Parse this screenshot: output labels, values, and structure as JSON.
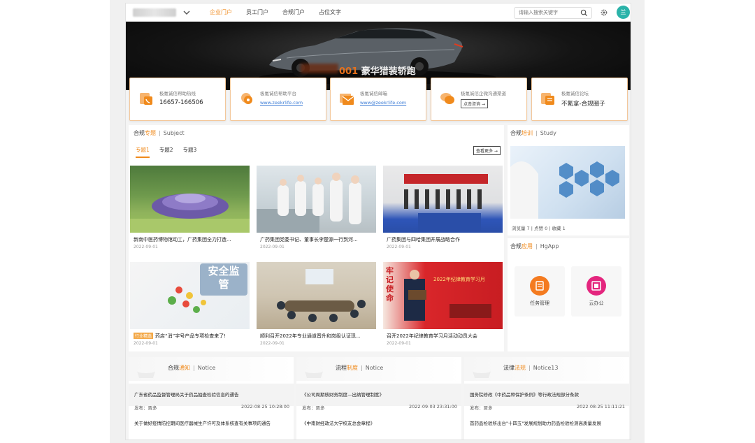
{
  "nav": {
    "tabs": [
      {
        "label": "企业门户"
      },
      {
        "label": "员工门户"
      },
      {
        "label": "合规门户"
      },
      {
        "label": "占位文字"
      }
    ],
    "search_placeholder": "请输入搜索关键字",
    "avatar_text": "兰"
  },
  "banner": {
    "number": "001",
    "title": "豪华猎装轿跑"
  },
  "cards": [
    {
      "label": "极氪诚信帮助热线",
      "value": "16657-166506"
    },
    {
      "label": "极氪诚信帮助平台",
      "link": "www.zeekrlife.com"
    },
    {
      "label": "极氪诚信邮箱",
      "link": "www@zeekrlife.com"
    },
    {
      "label": "极氪诚信企微沟通渠道",
      "button": "点击咨询 →"
    },
    {
      "label": "极氪诚信论坛",
      "value": "不氪拿-合规圈子"
    }
  ],
  "subject": {
    "title_prefix": "合规",
    "title_hl": "专题",
    "sep": "|",
    "title_en": "Subject",
    "tabs": [
      "专题1",
      "专题2",
      "专题3"
    ],
    "more": "查看更多 →",
    "news": [
      {
        "title": "新南中医药博物馆动工，广药集团全力打造...",
        "date": "2022-09-01"
      },
      {
        "title": "广药集团党委书记、董事长李楚源一行到河...",
        "date": "2022-09-01"
      },
      {
        "title": "广药集团与四哈集团开展战略合作",
        "date": "2022-09-01"
      },
      {
        "badge": "行业精选",
        "title": "药店“消”字号产品专项检查来了!",
        "date": "2022-09-01"
      },
      {
        "title": "顺利召开2022年专业通道晋升和岗级认证现...",
        "date": "2022-09-01"
      },
      {
        "title": "召开2022年纪律教育学习月活动动员大会",
        "date": "2022-09-01"
      }
    ],
    "img3_text": "安全监管",
    "img6_text": "2022年纪律教育学习月",
    "img6_side": "牢记使命"
  },
  "study": {
    "title_prefix": "合规",
    "title_hl": "培训",
    "sep": "|",
    "title_en": "Study",
    "stats": "浏览量 7  |  点赞 0  |  收藏 1"
  },
  "hgapp": {
    "title_prefix": "合规",
    "title_hl": "应用",
    "sep": "|",
    "title_en": "HgApp",
    "apps": [
      {
        "label": "任务管理",
        "icon": "task-icon",
        "color": "#f47b20"
      },
      {
        "label": "云办公",
        "icon": "cloud-office-icon",
        "color": "#e4267e"
      }
    ]
  },
  "notices": [
    {
      "title_prefix": "合规",
      "title_hl": "通知",
      "sep": "|",
      "title_en": "Notice",
      "items": [
        {
          "title": "广东省药品监督管理局关于药品抽查检验信息的通告",
          "publisher": "发布：贾多",
          "date": "2022-08-25 10:28:00"
        },
        {
          "title": "关于做好疫情防控期间医疗器械生产许可及体系核查有关事项的通告",
          "publisher": "",
          "date": ""
        }
      ]
    },
    {
      "title_prefix": "流程",
      "title_hl": "制度",
      "sep": "|",
      "title_en": "Notice",
      "items": [
        {
          "title": "《公司周期核财务制度—出纳管理制度》",
          "publisher": "发布：贾多",
          "date": "2022-09-03 23:31:00"
        },
        {
          "title": "《中南财经政法大学校友总会章程》",
          "publisher": "",
          "date": ""
        }
      ]
    },
    {
      "title_prefix": "法律",
      "title_hl": "法规",
      "sep": "|",
      "title_en": "Notice13",
      "items": [
        {
          "title": "国务院修改《中药品种保护条例》等行政法规部分条款",
          "publisher": "发布：贾多",
          "date": "2022-08-25 11:11:21"
        },
        {
          "title": "首药品检验所出台\"十四五\"发展规划助力药品检验检测高质量发展",
          "publisher": "",
          "date": ""
        }
      ]
    }
  ]
}
